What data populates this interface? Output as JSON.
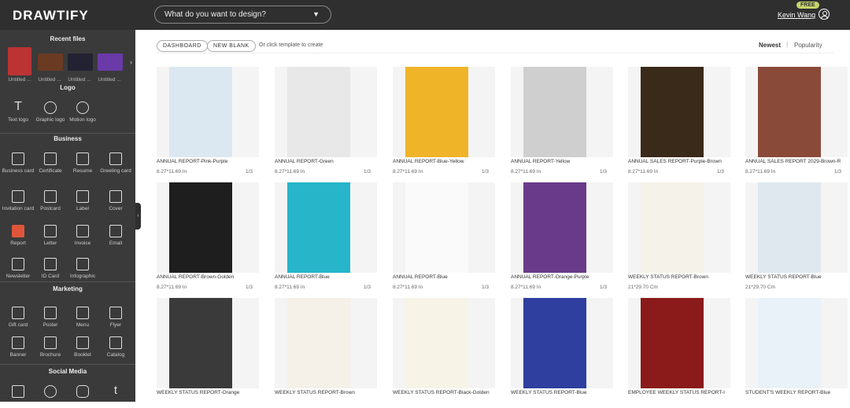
{
  "header": {
    "logo": "DRAWTIFY",
    "search_placeholder": "What do you want to design?",
    "badge": "FREE",
    "username": "Kevin Wang"
  },
  "sidebar": {
    "recent_title": "Recent files",
    "recent": [
      "Untitled ...",
      "Untitled ...",
      "Untitled ...",
      "Untitled ..."
    ],
    "logo_title": "Logo",
    "logo_items": [
      "Text logo",
      "Graphic logo",
      "Motion logo"
    ],
    "business_title": "Business",
    "business_items": [
      "Business card",
      "Certificate",
      "Resume",
      "Greeting card",
      "Invitation card",
      "Postcard",
      "Label",
      "Cover",
      "Report",
      "Letter",
      "Invoice",
      "Email",
      "Newsletter",
      "ID Card",
      "Infographic"
    ],
    "marketing_title": "Marketing",
    "marketing_items": [
      "Gift card",
      "Poster",
      "Menu",
      "Flyer",
      "Banner",
      "Brochure",
      "Booklet",
      "Catalog"
    ],
    "social_title": "Social Media"
  },
  "toolbar": {
    "dashboard": "DASHBOARD",
    "new_blank": "NEW BLANK",
    "hint": "Or click template to create",
    "sort_newest": "Newest",
    "sort_sep": "|",
    "sort_popularity": "Popularity"
  },
  "templates": [
    {
      "name": "ANNUAL REPORT-Pink-Purple",
      "size": "8.27*11.69 In",
      "pages": "1/3",
      "color": "#dbe8f2"
    },
    {
      "name": "ANNUAL REPORT-Green",
      "size": "8.27*11.69 In",
      "pages": "1/3",
      "color": "#e8e8e8"
    },
    {
      "name": "ANNUAL REPORT-Blue-Yellow",
      "size": "8.27*11.69 In",
      "pages": "1/3",
      "color": "#f0b429"
    },
    {
      "name": "ANNUAL REPORT-Yellow",
      "size": "8.27*11.69 In",
      "pages": "1/3",
      "color": "#cfcfcf"
    },
    {
      "name": "ANNUAL SALES REPORT-Purple-Brown",
      "size": "8.27*11.69 In",
      "pages": "1/3",
      "color": "#3a2a1a"
    },
    {
      "name": "ANNUAL SALES REPORT 2029-Brown-R",
      "size": "8.27*11.69 In",
      "pages": "1/3",
      "color": "#8a4a3a"
    },
    {
      "name": "ANNUAL REPORT-Brown-Golden",
      "size": "8.27*11.69 In",
      "pages": "1/3",
      "color": "#1e1e1e"
    },
    {
      "name": "ANNUAL REPORT-Blue",
      "size": "8.27*11.69 In",
      "pages": "1/3",
      "color": "#26b5c9"
    },
    {
      "name": "ANNUAL REPORT-Blue",
      "size": "8.27*11.69 In",
      "pages": "1/3",
      "color": "#fafafa"
    },
    {
      "name": "ANNUAL REPORT-Orange-Purple",
      "size": "8.27*11.69 In",
      "pages": "1/3",
      "color": "#6a3a8a"
    },
    {
      "name": "WEEKLY STATUS REPORT-Brown",
      "size": "21*29.70 Cm",
      "pages": "",
      "color": "#f5f2ea"
    },
    {
      "name": "WEEKLY STATUS REPORT-Blue",
      "size": "21*29.70 Cm",
      "pages": "",
      "color": "#dfe8ee"
    },
    {
      "name": "WEEKLY STATUS REPORT-Orange",
      "size": "",
      "pages": "",
      "color": "#3a3a3a"
    },
    {
      "name": "WEEKLY STATUS REPORT-Brown",
      "size": "",
      "pages": "",
      "color": "#f5f0e8"
    },
    {
      "name": "WEEKLY STATUS REPORT-Black-Golden",
      "size": "",
      "pages": "",
      "color": "#f7f3e6"
    },
    {
      "name": "WEEKLY STATUS REPORT-Blue",
      "size": "",
      "pages": "",
      "color": "#2f3f9f"
    },
    {
      "name": "EMPLOYEE WEEKLY STATUS REPORT-I",
      "size": "",
      "pages": "",
      "color": "#8b1a1a"
    },
    {
      "name": "STUDENT'S WEEKLY REPORT-Blue",
      "size": "",
      "pages": "",
      "color": "#e9f2f8"
    }
  ]
}
